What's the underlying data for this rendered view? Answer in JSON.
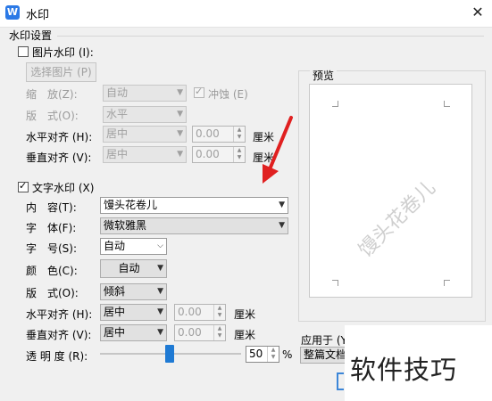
{
  "window": {
    "title": "水印",
    "close": "✕"
  },
  "settings": {
    "group_label": "水印设置"
  },
  "picture_watermark": {
    "label": "图片水印 (I):",
    "checked": false,
    "select_button": "选择图片 (P)",
    "scale_label": "缩　放(Z):",
    "scale_value": "自动",
    "washout_label": "冲蚀 (E)",
    "layout_label": "版　式(O):",
    "layout_value": "水平",
    "h_align_label": "水平对齐 (H):",
    "h_align_value": "居中",
    "h_offset": "0.00",
    "v_align_label": "垂直对齐 (V):",
    "v_align_value": "居中",
    "v_offset": "0.00",
    "unit": "厘米"
  },
  "text_watermark": {
    "label": "文字水印 (X)",
    "checked": true,
    "content_label": "内　容(T):",
    "content_value": "馒头花卷儿",
    "font_label": "字　体(F):",
    "font_value": "微软雅黑",
    "size_label": "字　号(S):",
    "size_value": "自动",
    "color_label": "颜　色(C):",
    "color_value": "自动",
    "layout_label": "版　式(O):",
    "layout_value": "倾斜",
    "h_align_label": "水平对齐 (H):",
    "h_align_value": "居中",
    "h_offset": "0.00",
    "v_align_label": "垂直对齐 (V):",
    "v_align_value": "居中",
    "v_offset": "0.00",
    "unit": "厘米",
    "transparency_label": "透 明 度 (R):",
    "transparency_value": "50",
    "transparency_unit": "%"
  },
  "preview": {
    "label": "预览",
    "watermark_text": "馒头花卷儿"
  },
  "apply": {
    "label": "应用于 (Y",
    "value": "整篇文档"
  },
  "overlay": {
    "text": "软件技巧"
  },
  "icons": {
    "dropdown": "chevron-down-icon",
    "spin": "spin-updown-icon",
    "arrow": "red-arrow-annotation"
  },
  "colors": {
    "accent": "#1f7ad4",
    "annotation": "#e02020"
  }
}
